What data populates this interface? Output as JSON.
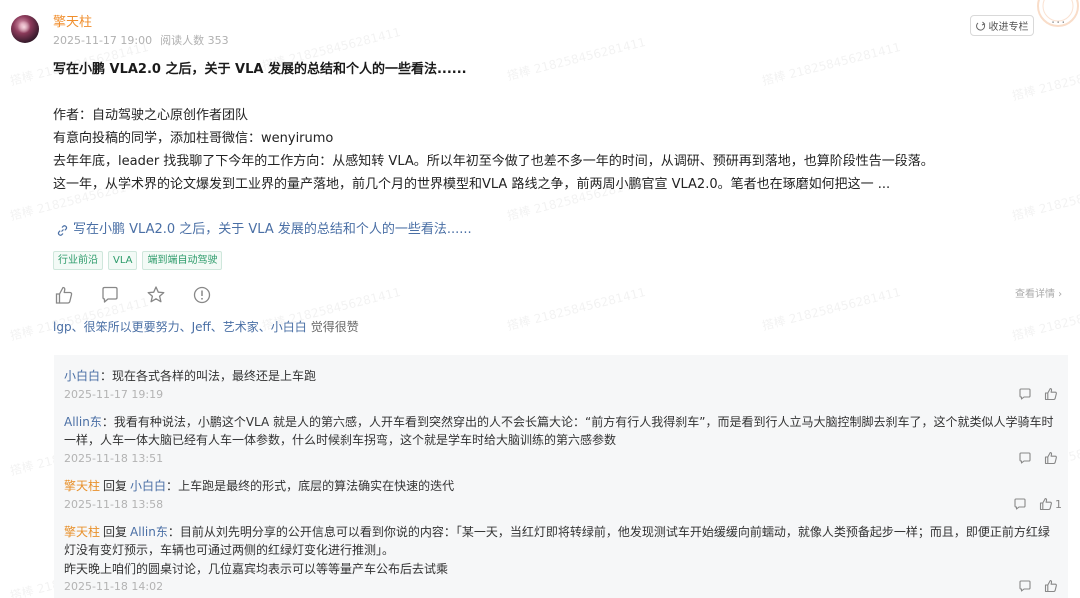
{
  "header": {
    "author": "擎天柱",
    "date": "2025-11-17 19:00",
    "read_label": "阅读人数 353",
    "collect_label": "收进专栏",
    "more_label": "···"
  },
  "post": {
    "title": "写在小鹏 VLA2.0 之后，关于 VLA 发展的总结和个人的一些看法......",
    "lines": [
      "作者：自动驾驶之心原创作者团队",
      "有意向投稿的同学，添加柱哥微信：wenyirumo",
      "去年年底，leader 找我聊了下今年的工作方向：从感知转 VLA。所以年初至今做了也差不多一年的时间，从调研、预研再到落地，也算阶段性告一段落。",
      "这一年，从学术界的论文爆发到工业界的量产落地，前几个月的世界模型和VLA 路线之争，前两周小鹏官宣 VLA2.0。笔者也在琢磨如何把这一 ..."
    ],
    "link_text": "写在小鹏 VLA2.0 之后，关于 VLA 发展的总结和个人的一些看法......",
    "tags": [
      "行业前沿",
      "VLA",
      "端到端自动驾驶"
    ]
  },
  "actions": {
    "view_detail": "查看详情 ›"
  },
  "likers": {
    "names": "lgp、很笨所以更要努力、Jeff、艺术家、小白白",
    "suffix": "觉得很赞"
  },
  "comments": [
    {
      "user": "小白白",
      "reply_word": "",
      "reply_to": "",
      "text": "现在各式各样的叫法，最终还是上车跑",
      "time": "2025-11-17 19:19",
      "like_count": ""
    },
    {
      "user": "Allin东",
      "reply_word": "",
      "reply_to": "",
      "text": "我看有种说法，小鹏这个VLA 就是人的第六感，人开车看到突然穿出的人不会长篇大论：“前方有行人我得刹车”，而是看到行人立马大脑控制脚去刹车了，这个就类似人学骑车时一样，人车一体大脑已经有人车一体参数，什么时候刹车拐弯，这个就是学车时给大脑训练的第六感参数",
      "time": "2025-11-18 13:51",
      "like_count": ""
    },
    {
      "user": "擎天柱",
      "reply_word": "回复",
      "reply_to": "小白白",
      "text": "上车跑是最终的形式，底层的算法确实在快速的迭代",
      "time": "2025-11-18 13:58",
      "like_count": "1"
    },
    {
      "user": "擎天柱",
      "reply_word": "回复",
      "reply_to": "Allin东",
      "text": "目前从刘先明分享的公开信息可以看到你说的内容：「某一天，当红灯即将转绿前，他发现测试车开始缓缓向前蠕动，就像人类预备起步一样；而且，即便正前方红绿灯没有变灯预示，车辆也可通过两侧的红绿灯变化进行推测」。",
      "text2": "昨天晚上咱们的圆桌讨论，几位嘉宾均表示可以等等量产车公布后去试乘",
      "time": "2025-11-18 14:02",
      "like_count": ""
    }
  ],
  "watermark": "搭棒 218258456281411"
}
